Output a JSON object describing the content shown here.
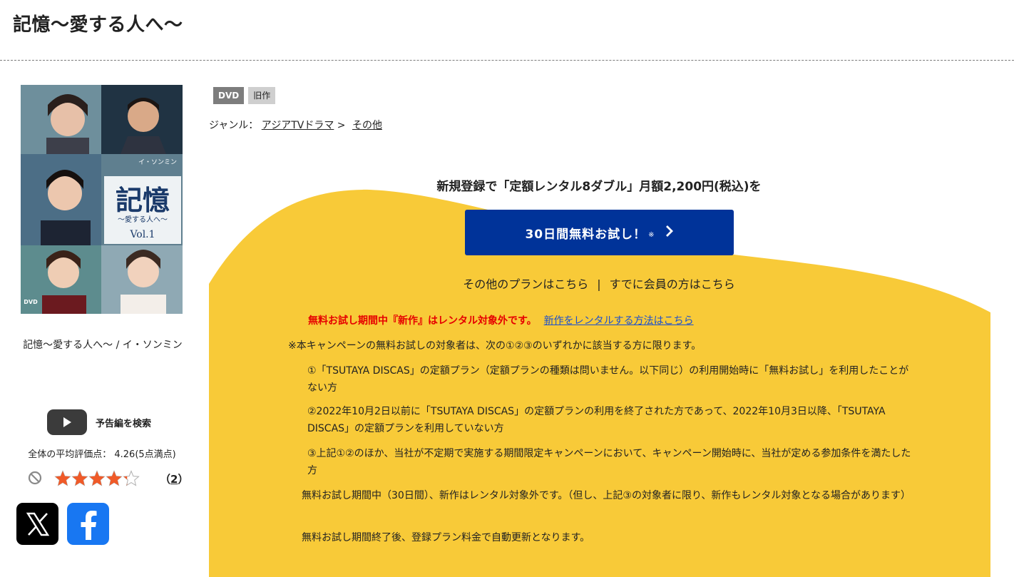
{
  "page": {
    "title": "記憶～愛する人へ～"
  },
  "item": {
    "title_line": "記憶～愛する人へ～ / イ・ソンミン",
    "badges": [
      "DVD",
      "旧作"
    ],
    "genre_label": "ジャンル：",
    "genre_path": [
      "アジアTVドラマ",
      "その他"
    ],
    "genre_sep": ">"
  },
  "jacket": {
    "title_main": "記憶",
    "title_sub": "～愛する人へ～",
    "volume": "Vol.1",
    "actor_name": "イ・ソンミン",
    "dvd_mark": "DVD"
  },
  "trailer": {
    "label": "予告編を検索",
    "icon": "youtube-play-icon"
  },
  "rating": {
    "average_text": "全体の平均評価点： 4.26(5点満点)",
    "score": 4.26,
    "max": 5,
    "review_open": "（",
    "review_count": "2",
    "review_close": "）"
  },
  "share": {
    "x_icon": "x-logo-icon",
    "facebook_icon": "facebook-logo-icon"
  },
  "campaign": {
    "headline": "新規登録で「定額レンタル8ダブル」月額2,200円(税込)を",
    "button_label": "30日間無料お試し！",
    "button_mark": "※",
    "other_plans": "その他のプランはこちら",
    "separator": "|",
    "member_link": "すでに会員の方はこちら",
    "notice_red": "無料お試し期間中『新作』はレンタル対象外です。",
    "notice_link": "新作をレンタルする方法はこちら",
    "conditions_intro": "※本キャンペーンの無料お試しの対象者は、次の①②③のいずれかに該当する方に限ります。",
    "conditions": [
      "①「TSUTAYA DISCAS」の定額プラン（定額プランの種類は問いません。以下同じ）の利用開始時に「無料お試し」を利用したことがない方",
      "②2022年10月2日以前に「TSUTAYA DISCAS」の定額プランの利用を終了された方であって、2022年10月3日以降、「TSUTAYA DISCAS」の定額プランを利用していない方",
      "③上記①②のほか、当社が不定期で実施する期間限定キャンペーンにおいて、キャンペーン開始時に、当社が定める参加条件を満たした方"
    ],
    "note_1": "無料お試し期間中（30日間）、新作はレンタル対象外です。（但し、上記③の対象者に限り、新作もレンタル対象となる場合があります）",
    "note_2": "無料お試し期間終了後、登録プラン料金で自動更新となります。"
  },
  "colors": {
    "accent_yellow": "#f8ca38",
    "button_blue": "#003399",
    "notice_red": "#e60000",
    "link_blue": "#1a4fcf",
    "star_orange": "#f05a28"
  }
}
